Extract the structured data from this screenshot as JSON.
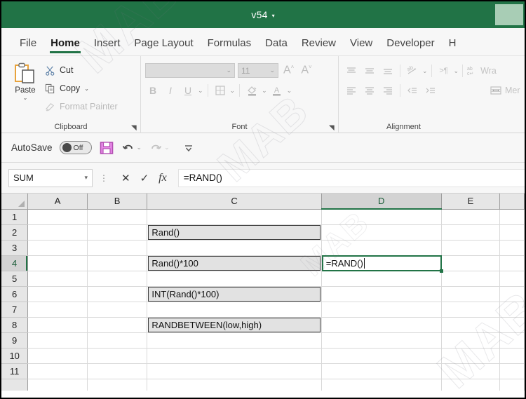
{
  "window": {
    "title": "v54",
    "title_caret": "▾",
    "accent_green": "#217346",
    "watermark": "MAB"
  },
  "tabs": [
    {
      "label": "File",
      "active": false
    },
    {
      "label": "Home",
      "active": true
    },
    {
      "label": "Insert",
      "active": false
    },
    {
      "label": "Page Layout",
      "active": false
    },
    {
      "label": "Formulas",
      "active": false
    },
    {
      "label": "Data",
      "active": false
    },
    {
      "label": "Review",
      "active": false
    },
    {
      "label": "View",
      "active": false
    },
    {
      "label": "Developer",
      "active": false
    },
    {
      "label": "H",
      "active": false
    }
  ],
  "ribbon": {
    "clipboard": {
      "group_label": "Clipboard",
      "paste_label": "Paste",
      "paste_caret": "⌄",
      "cut_label": "Cut",
      "copy_label": "Copy",
      "copy_caret": "⌄",
      "format_painter_label": "Format Painter",
      "launcher": "◥"
    },
    "font": {
      "group_label": "Font",
      "font_name_value": "",
      "font_size_value": "11",
      "grow_font": "A",
      "shrink_font": "A",
      "bold": "B",
      "italic": "I",
      "underline": "U",
      "launcher": "◥"
    },
    "alignment": {
      "group_label": "Alignment",
      "wrap_text_label": "Wra",
      "merge_label": "Mer",
      "orientation_caret": "⌄",
      "direction_label": ">¶"
    }
  },
  "quick_access": {
    "autosave_label": "AutoSave",
    "autosave_state": "Off",
    "save_icon": "save-icon",
    "undo_icon": "undo-icon",
    "redo_icon": "redo-icon",
    "customize_icon": "customize-icon"
  },
  "formula_bar": {
    "name_box_value": "SUM",
    "name_box_caret": "▾",
    "cancel": "✕",
    "enter": "✓",
    "insert_function": "fx",
    "formula_value": "=RAND()"
  },
  "grid": {
    "columns": [
      "A",
      "B",
      "C",
      "D",
      "E"
    ],
    "selected_column": "D",
    "rows": [
      "1",
      "2",
      "3",
      "4",
      "5",
      "6",
      "7",
      "8",
      "9",
      "10",
      "11"
    ],
    "selected_row": "4",
    "active_cell": "D4",
    "active_cell_text": "=RAND()",
    "cells": [
      {
        "ref": "C2",
        "text": "Rand()",
        "style": "boxed"
      },
      {
        "ref": "C4",
        "text": "Rand()*100",
        "style": "boxed"
      },
      {
        "ref": "C6",
        "text": "INT(Rand()*100)",
        "style": "boxed"
      },
      {
        "ref": "C8",
        "text": "RANDBETWEEN(low,high)",
        "style": "boxed"
      }
    ]
  }
}
